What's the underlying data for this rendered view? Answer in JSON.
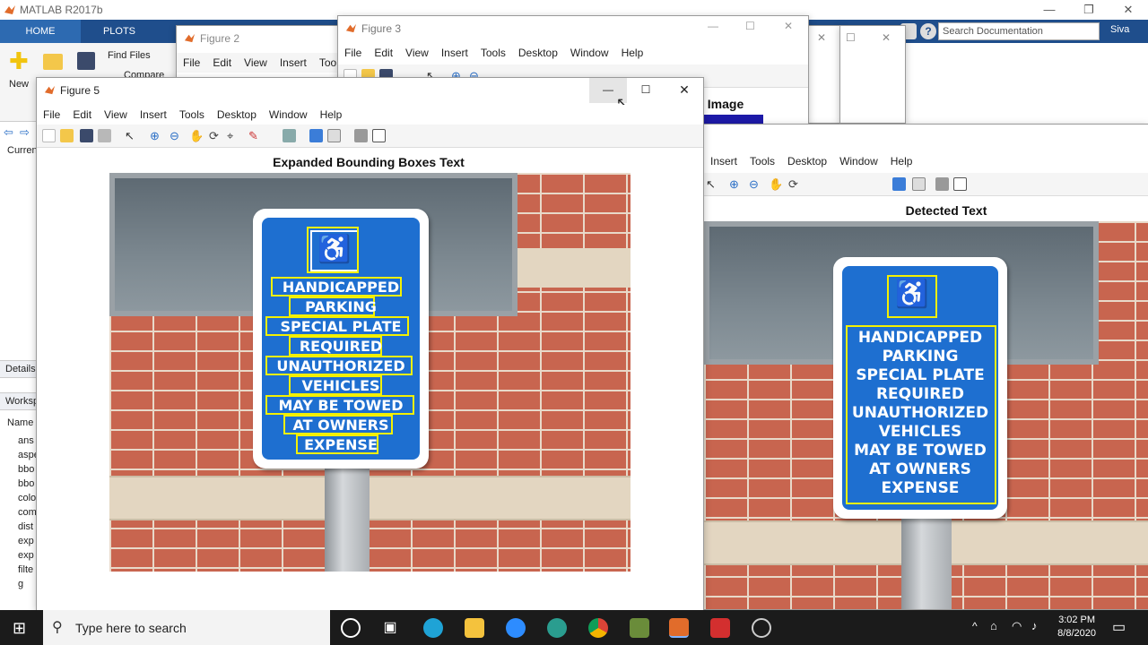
{
  "app": {
    "title": "MATLAB R2017b",
    "user": "Siva"
  },
  "ribbon": {
    "tabs": [
      "HOME",
      "PLOTS"
    ],
    "buttons": {
      "new": "New",
      "find_files": "Find Files",
      "compare": "Compare"
    },
    "search_placeholder": "Search Documentation"
  },
  "left_pane": {
    "current_folder": "Curren",
    "details": "Details",
    "workspace": "Worksp",
    "name_header": "Name",
    "vars": [
      "ans",
      "aspe",
      "bbo",
      "bbo",
      "colo",
      "com",
      "dist",
      "exp",
      "exp",
      "filte",
      "g"
    ]
  },
  "menu": [
    "File",
    "Edit",
    "View",
    "Insert",
    "Tools",
    "Desktop",
    "Window",
    "Help"
  ],
  "fig2": {
    "title": "Figure 2"
  },
  "fig3": {
    "title": "Figure 3",
    "axes_title": "Image"
  },
  "fig5": {
    "title": "Figure 5",
    "axes_title": "Expanded Bounding Boxes Text"
  },
  "fig_right": {
    "axes_title": "Detected Text"
  },
  "sign_lines": [
    "HANDICAPPED",
    "PARKING",
    "SPECIAL PLATE",
    "REQUIRED",
    "UNAUTHORIZED",
    "VEHICLES",
    "MAY BE TOWED",
    "AT OWNERS",
    "EXPENSE"
  ],
  "taskbar": {
    "search_placeholder": "Type here to search",
    "time": "3:02 PM",
    "date": "8/8/2020"
  },
  "icons": [
    "windows-start-icon",
    "search-icon",
    "cortana-icon",
    "task-view-icon",
    "edge-icon",
    "file-explorer-icon",
    "zoom-icon",
    "chrome-icon",
    "matlab-icon",
    "acrobat-icon"
  ]
}
